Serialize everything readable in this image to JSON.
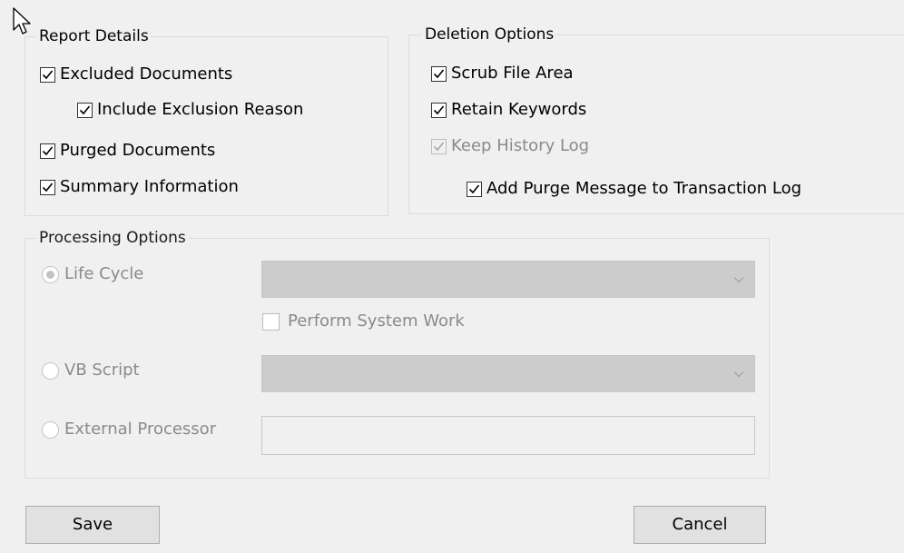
{
  "report_details": {
    "title": "Report Details",
    "items": [
      {
        "label": "Excluded Documents",
        "checked": true
      },
      {
        "label": "Include Exclusion Reason",
        "checked": true
      },
      {
        "label": "Purged Documents",
        "checked": true
      },
      {
        "label": "Summary Information",
        "checked": true
      }
    ]
  },
  "deletion_options": {
    "title": "Deletion Options",
    "items": [
      {
        "label": "Scrub File Area",
        "checked": true,
        "enabled": true
      },
      {
        "label": "Retain Keywords",
        "checked": true,
        "enabled": true
      },
      {
        "label": "Keep History Log",
        "checked": true,
        "enabled": false
      },
      {
        "label": "Add Purge Message to Transaction Log",
        "checked": true,
        "enabled": true
      }
    ]
  },
  "processing_options": {
    "title": "Processing Options",
    "life_cycle": {
      "label": "Life Cycle",
      "selected": true,
      "enabled": false
    },
    "life_cycle_value": "",
    "perform_system_work": {
      "label": "Perform System Work",
      "checked": false,
      "enabled": false
    },
    "vb_script": {
      "label": "VB Script",
      "selected": false,
      "enabled": false
    },
    "vb_script_value": "",
    "external_processor": {
      "label": "External Processor",
      "selected": false,
      "enabled": false
    },
    "external_processor_value": ""
  },
  "buttons": {
    "save": "Save",
    "cancel": "Cancel"
  },
  "icons": {
    "check": "check-icon",
    "dropdown": "chevron-down-icon",
    "cursor": "mouse-pointer-icon"
  }
}
